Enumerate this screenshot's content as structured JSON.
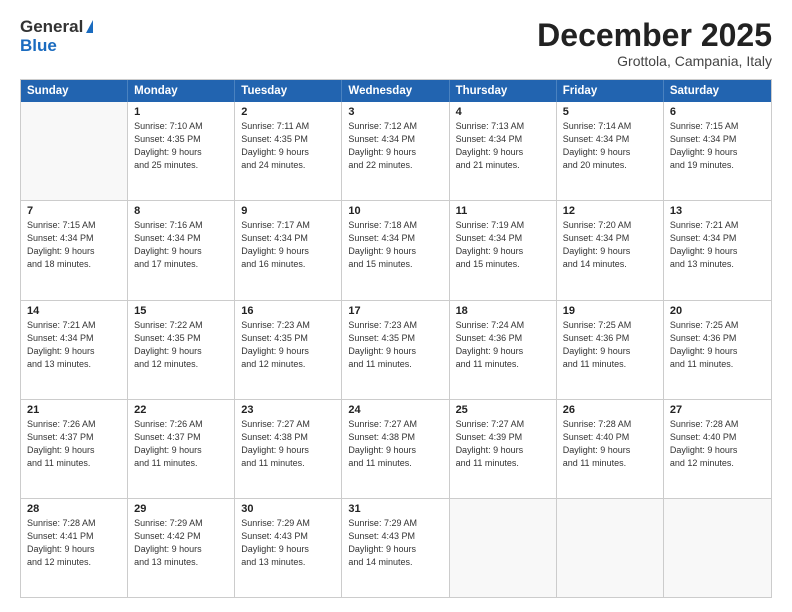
{
  "header": {
    "logo_general": "General",
    "logo_blue": "Blue",
    "month_title": "December 2025",
    "location": "Grottola, Campania, Italy"
  },
  "calendar": {
    "days_of_week": [
      "Sunday",
      "Monday",
      "Tuesday",
      "Wednesday",
      "Thursday",
      "Friday",
      "Saturday"
    ],
    "rows": [
      [
        {
          "day": "",
          "lines": []
        },
        {
          "day": "1",
          "lines": [
            "Sunrise: 7:10 AM",
            "Sunset: 4:35 PM",
            "Daylight: 9 hours",
            "and 25 minutes."
          ]
        },
        {
          "day": "2",
          "lines": [
            "Sunrise: 7:11 AM",
            "Sunset: 4:35 PM",
            "Daylight: 9 hours",
            "and 24 minutes."
          ]
        },
        {
          "day": "3",
          "lines": [
            "Sunrise: 7:12 AM",
            "Sunset: 4:34 PM",
            "Daylight: 9 hours",
            "and 22 minutes."
          ]
        },
        {
          "day": "4",
          "lines": [
            "Sunrise: 7:13 AM",
            "Sunset: 4:34 PM",
            "Daylight: 9 hours",
            "and 21 minutes."
          ]
        },
        {
          "day": "5",
          "lines": [
            "Sunrise: 7:14 AM",
            "Sunset: 4:34 PM",
            "Daylight: 9 hours",
            "and 20 minutes."
          ]
        },
        {
          "day": "6",
          "lines": [
            "Sunrise: 7:15 AM",
            "Sunset: 4:34 PM",
            "Daylight: 9 hours",
            "and 19 minutes."
          ]
        }
      ],
      [
        {
          "day": "7",
          "lines": [
            "Sunrise: 7:15 AM",
            "Sunset: 4:34 PM",
            "Daylight: 9 hours",
            "and 18 minutes."
          ]
        },
        {
          "day": "8",
          "lines": [
            "Sunrise: 7:16 AM",
            "Sunset: 4:34 PM",
            "Daylight: 9 hours",
            "and 17 minutes."
          ]
        },
        {
          "day": "9",
          "lines": [
            "Sunrise: 7:17 AM",
            "Sunset: 4:34 PM",
            "Daylight: 9 hours",
            "and 16 minutes."
          ]
        },
        {
          "day": "10",
          "lines": [
            "Sunrise: 7:18 AM",
            "Sunset: 4:34 PM",
            "Daylight: 9 hours",
            "and 15 minutes."
          ]
        },
        {
          "day": "11",
          "lines": [
            "Sunrise: 7:19 AM",
            "Sunset: 4:34 PM",
            "Daylight: 9 hours",
            "and 15 minutes."
          ]
        },
        {
          "day": "12",
          "lines": [
            "Sunrise: 7:20 AM",
            "Sunset: 4:34 PM",
            "Daylight: 9 hours",
            "and 14 minutes."
          ]
        },
        {
          "day": "13",
          "lines": [
            "Sunrise: 7:21 AM",
            "Sunset: 4:34 PM",
            "Daylight: 9 hours",
            "and 13 minutes."
          ]
        }
      ],
      [
        {
          "day": "14",
          "lines": [
            "Sunrise: 7:21 AM",
            "Sunset: 4:34 PM",
            "Daylight: 9 hours",
            "and 13 minutes."
          ]
        },
        {
          "day": "15",
          "lines": [
            "Sunrise: 7:22 AM",
            "Sunset: 4:35 PM",
            "Daylight: 9 hours",
            "and 12 minutes."
          ]
        },
        {
          "day": "16",
          "lines": [
            "Sunrise: 7:23 AM",
            "Sunset: 4:35 PM",
            "Daylight: 9 hours",
            "and 12 minutes."
          ]
        },
        {
          "day": "17",
          "lines": [
            "Sunrise: 7:23 AM",
            "Sunset: 4:35 PM",
            "Daylight: 9 hours",
            "and 11 minutes."
          ]
        },
        {
          "day": "18",
          "lines": [
            "Sunrise: 7:24 AM",
            "Sunset: 4:36 PM",
            "Daylight: 9 hours",
            "and 11 minutes."
          ]
        },
        {
          "day": "19",
          "lines": [
            "Sunrise: 7:25 AM",
            "Sunset: 4:36 PM",
            "Daylight: 9 hours",
            "and 11 minutes."
          ]
        },
        {
          "day": "20",
          "lines": [
            "Sunrise: 7:25 AM",
            "Sunset: 4:36 PM",
            "Daylight: 9 hours",
            "and 11 minutes."
          ]
        }
      ],
      [
        {
          "day": "21",
          "lines": [
            "Sunrise: 7:26 AM",
            "Sunset: 4:37 PM",
            "Daylight: 9 hours",
            "and 11 minutes."
          ]
        },
        {
          "day": "22",
          "lines": [
            "Sunrise: 7:26 AM",
            "Sunset: 4:37 PM",
            "Daylight: 9 hours",
            "and 11 minutes."
          ]
        },
        {
          "day": "23",
          "lines": [
            "Sunrise: 7:27 AM",
            "Sunset: 4:38 PM",
            "Daylight: 9 hours",
            "and 11 minutes."
          ]
        },
        {
          "day": "24",
          "lines": [
            "Sunrise: 7:27 AM",
            "Sunset: 4:38 PM",
            "Daylight: 9 hours",
            "and 11 minutes."
          ]
        },
        {
          "day": "25",
          "lines": [
            "Sunrise: 7:27 AM",
            "Sunset: 4:39 PM",
            "Daylight: 9 hours",
            "and 11 minutes."
          ]
        },
        {
          "day": "26",
          "lines": [
            "Sunrise: 7:28 AM",
            "Sunset: 4:40 PM",
            "Daylight: 9 hours",
            "and 11 minutes."
          ]
        },
        {
          "day": "27",
          "lines": [
            "Sunrise: 7:28 AM",
            "Sunset: 4:40 PM",
            "Daylight: 9 hours",
            "and 12 minutes."
          ]
        }
      ],
      [
        {
          "day": "28",
          "lines": [
            "Sunrise: 7:28 AM",
            "Sunset: 4:41 PM",
            "Daylight: 9 hours",
            "and 12 minutes."
          ]
        },
        {
          "day": "29",
          "lines": [
            "Sunrise: 7:29 AM",
            "Sunset: 4:42 PM",
            "Daylight: 9 hours",
            "and 13 minutes."
          ]
        },
        {
          "day": "30",
          "lines": [
            "Sunrise: 7:29 AM",
            "Sunset: 4:43 PM",
            "Daylight: 9 hours",
            "and 13 minutes."
          ]
        },
        {
          "day": "31",
          "lines": [
            "Sunrise: 7:29 AM",
            "Sunset: 4:43 PM",
            "Daylight: 9 hours",
            "and 14 minutes."
          ]
        },
        {
          "day": "",
          "lines": []
        },
        {
          "day": "",
          "lines": []
        },
        {
          "day": "",
          "lines": []
        }
      ]
    ]
  }
}
